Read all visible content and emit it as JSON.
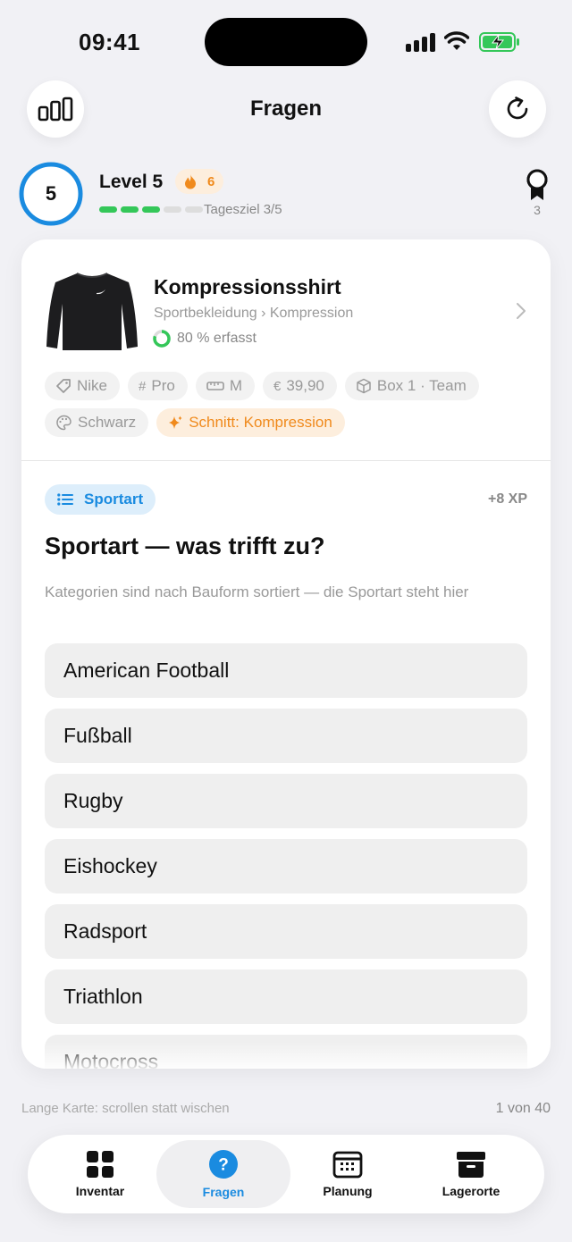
{
  "status": {
    "time": "09:41"
  },
  "header": {
    "title": "Fragen"
  },
  "level": {
    "number": "5",
    "label": "Level 5",
    "streak": "6",
    "daily_goal": "Tagesziel 3/5",
    "daily_progress": 0.6,
    "badges": "3"
  },
  "product": {
    "name": "Kompressionsshirt",
    "category": "Sportbekleidung › Kompression",
    "captured": "80 % erfasst",
    "captured_fraction": 0.8,
    "tags": [
      {
        "icon": "tag-icon",
        "label": "Nike"
      },
      {
        "icon": "hash-icon",
        "label": "Pro"
      },
      {
        "icon": "ruler-icon",
        "label": "M"
      },
      {
        "icon": "euro-icon",
        "label": "39,90"
      },
      {
        "icon": "box-icon",
        "label": "Box 1 · Team"
      },
      {
        "icon": "palette-icon",
        "label": "Schwarz"
      },
      {
        "icon": "sparkle-icon",
        "label": "Schnitt: Kompression"
      }
    ]
  },
  "question": {
    "badge": "Sportart",
    "xp": "+8 XP",
    "title": "Sportart — was trifft zu?",
    "hint": "Kategorien sind nach Bauform sortiert — die Sportart steht hier",
    "options": [
      "American Football",
      "Fußball",
      "Rugby",
      "Eishockey",
      "Radsport",
      "Triathlon",
      "Motocross"
    ]
  },
  "footer": {
    "hint": "Lange Karte: scrollen statt wischen",
    "pager": "1 von 40"
  },
  "tabs": [
    {
      "label": "Inventar",
      "icon": "grid-icon"
    },
    {
      "label": "Fragen",
      "icon": "question-icon"
    },
    {
      "label": "Planung",
      "icon": "calendar-icon"
    },
    {
      "label": "Lagerorte",
      "icon": "archive-icon"
    }
  ],
  "colors": {
    "accent": "#1a8be0",
    "green": "#34c759",
    "orange": "#f08a1c"
  }
}
